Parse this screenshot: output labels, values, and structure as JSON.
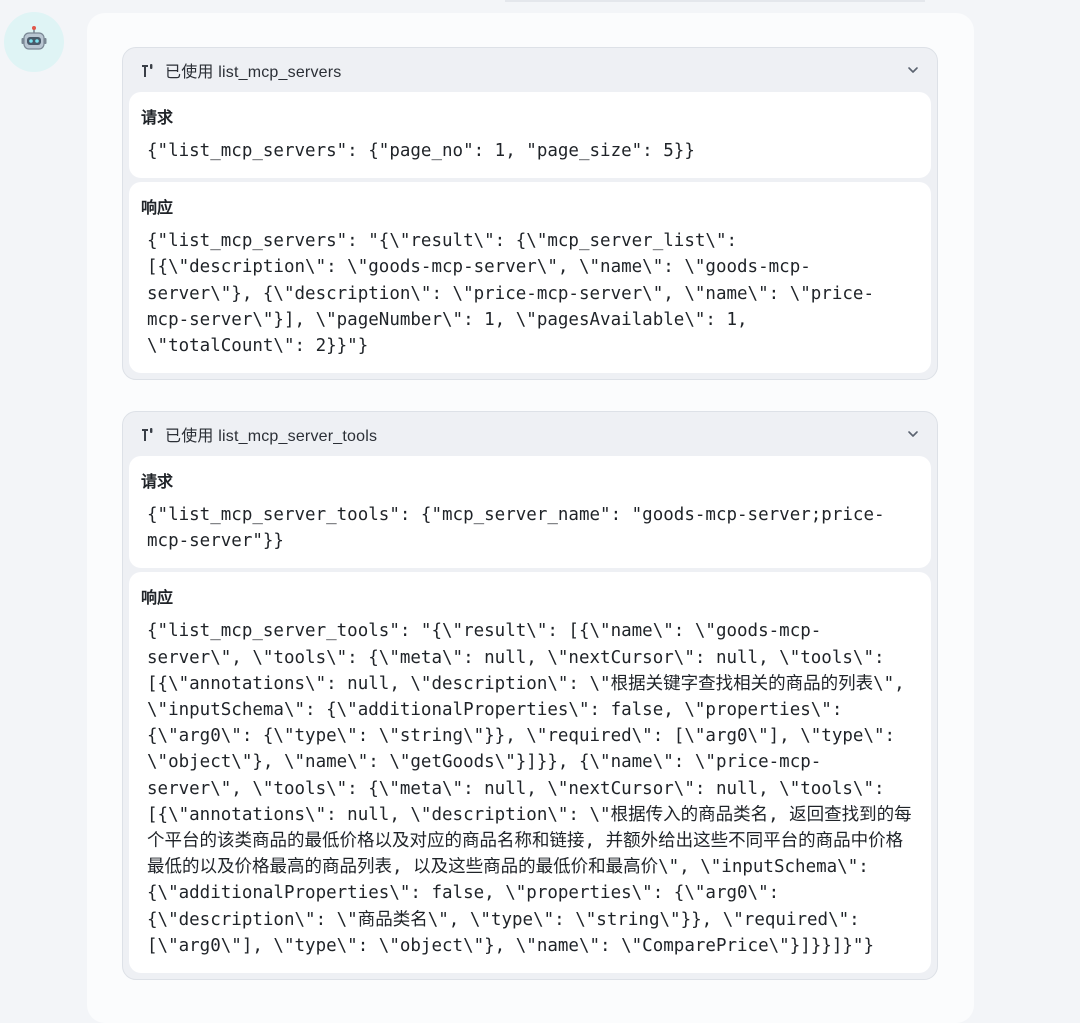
{
  "avatar": {
    "icon": "robot-icon"
  },
  "tools": [
    {
      "title": "已使用 list_mcp_servers",
      "request_label": "请求",
      "request": "{\"list_mcp_servers\": {\"page_no\": 1, \"page_size\": 5}}",
      "response_label": "响应",
      "response": "{\"list_mcp_servers\": \"{\\\"result\\\": {\\\"mcp_server_list\\\":\n[{\\\"description\\\": \\\"goods-mcp-server\\\", \\\"name\\\": \\\"goods-mcp-\nserver\\\"}, {\\\"description\\\": \\\"price-mcp-server\\\", \\\"name\\\": \\\"price-\nmcp-server\\\"}], \\\"pageNumber\\\": 1, \\\"pagesAvailable\\\": 1,\n\\\"totalCount\\\": 2}}\"}"
    },
    {
      "title": "已使用 list_mcp_server_tools",
      "request_label": "请求",
      "request": "{\"list_mcp_server_tools\": {\"mcp_server_name\": \"goods-mcp-server;price-\nmcp-server\"}}",
      "response_label": "响应",
      "response": "{\"list_mcp_server_tools\": \"{\\\"result\\\": [{\\\"name\\\": \\\"goods-mcp-\nserver\\\", \\\"tools\\\": {\\\"meta\\\": null, \\\"nextCursor\\\": null, \\\"tools\\\":\n[{\\\"annotations\\\": null, \\\"description\\\": \\\"根据关键字查找相关的商品的列表\\\",\n\\\"inputSchema\\\": {\\\"additionalProperties\\\": false, \\\"properties\\\":\n{\\\"arg0\\\": {\\\"type\\\": \\\"string\\\"}}, \\\"required\\\": [\\\"arg0\\\"], \\\"type\\\":\n\\\"object\\\"}, \\\"name\\\": \\\"getGoods\\\"}]}}, {\\\"name\\\": \\\"price-mcp-\nserver\\\", \\\"tools\\\": {\\\"meta\\\": null, \\\"nextCursor\\\": null, \\\"tools\\\":\n[{\\\"annotations\\\": null, \\\"description\\\": \\\"根据传入的商品类名, 返回查找到的每\n个平台的该类商品的最低价格以及对应的商品名称和链接, 并额外给出这些不同平台的商品中价格\n最低的以及价格最高的商品列表, 以及这些商品的最低价和最高价\\\", \\\"inputSchema\\\":\n{\\\"additionalProperties\\\": false, \\\"properties\\\": {\\\"arg0\\\":\n{\\\"description\\\": \\\"商品类名\\\", \\\"type\\\": \\\"string\\\"}}, \\\"required\\\":\n[\\\"arg0\\\"], \\\"type\\\": \\\"object\\\"}, \\\"name\\\": \\\"ComparePrice\\\"}]}}]}\"}"
    }
  ]
}
